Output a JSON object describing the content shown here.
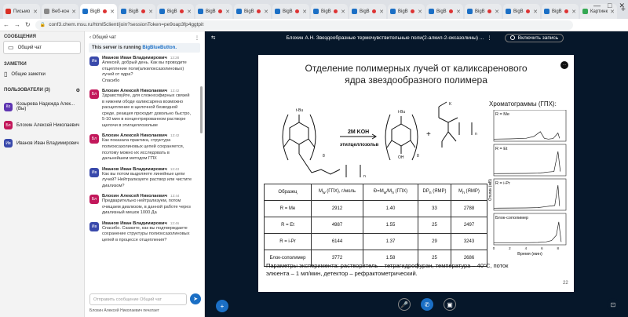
{
  "tabs": [
    {
      "label": "Письмо",
      "fav": "#d93025",
      "active": false,
      "rec": false
    },
    {
      "label": "Веб-кон",
      "fav": "#888888",
      "active": false,
      "rec": false
    },
    {
      "label": "BigB",
      "fav": "#1b6fc5",
      "active": true,
      "rec": true
    },
    {
      "label": "BigB",
      "fav": "#1b6fc5",
      "active": false,
      "rec": true
    },
    {
      "label": "BigB",
      "fav": "#1b6fc5",
      "active": false,
      "rec": true
    },
    {
      "label": "BigB",
      "fav": "#1b6fc5",
      "active": false,
      "rec": true
    },
    {
      "label": "BigB",
      "fav": "#1b6fc5",
      "active": false,
      "rec": true
    },
    {
      "label": "BigB",
      "fav": "#1b6fc5",
      "active": false,
      "rec": true
    },
    {
      "label": "BigB",
      "fav": "#1b6fc5",
      "active": false,
      "rec": true
    },
    {
      "label": "BigB",
      "fav": "#1b6fc5",
      "active": false,
      "rec": true
    },
    {
      "label": "BigB",
      "fav": "#1b6fc5",
      "active": false,
      "rec": true
    },
    {
      "label": "BigB",
      "fav": "#1b6fc5",
      "active": false,
      "rec": true
    },
    {
      "label": "BigB",
      "fav": "#1b6fc5",
      "active": false,
      "rec": true
    },
    {
      "label": "BigB",
      "fav": "#1b6fc5",
      "active": false,
      "rec": true
    },
    {
      "label": "BigB",
      "fav": "#1b6fc5",
      "active": false,
      "rec": true
    },
    {
      "label": "Картинк",
      "fav": "#34a853",
      "active": false,
      "rec": false
    }
  ],
  "window_controls": {
    "minimize": "—",
    "maximize": "□",
    "close": "✕"
  },
  "address": {
    "back": "←",
    "forward": "→",
    "reload": "↻",
    "lock": "🔒",
    "url": "conf3.chem.msu.ru/html5client/join?sessionToken=pe9oap3fp4ggtpit"
  },
  "nav": {
    "messages_title": "СООБЩЕНИЯ",
    "public_chat": "Общий чат",
    "notes_title": "ЗАМЕТКИ",
    "shared_notes": "Общие заметки",
    "users_title": "ПОЛЬЗОВАТЕЛИ (3)",
    "users": [
      {
        "initials": "Ко",
        "name": "Козырева Надежда Алек...(Вы)",
        "color": "#5e35b1"
      },
      {
        "initials": "Бл",
        "name": "Блохин Алексей Николаевич",
        "color": "#c2185b"
      },
      {
        "initials": "Ив",
        "name": "Иванов Иван Владимирович",
        "color": "#3949ab"
      }
    ]
  },
  "chat": {
    "header": "Общий чат",
    "back": "‹",
    "menu": "⋮",
    "banner_prefix": "This server is running ",
    "banner_link": "BigBlueButton.",
    "messages": [
      {
        "initials": "Ив",
        "color": "#3949ab",
        "name": "Иванов Иван Владимирович",
        "time": "13:28",
        "lines": [
          "Алексей, добрый день. Как вы проводите",
          "отщепление поли(алкилоксазолиновых)",
          "лучей от ядра?",
          "Спасибо"
        ]
      },
      {
        "initials": "Бл",
        "color": "#c2185b",
        "name": "Блохин Алексей Николаевич",
        "time": "13:42",
        "lines": [
          "Здравствуйте, для сложноэфирных связей",
          "в нижнем ободе каликсарена возможно",
          "расщепление в щелочной безводной",
          "среде, реакция проходит довольно быстро,",
          "5-10 мин в концентрированном растворе",
          "щелочи в этилцеллозольве"
        ]
      },
      {
        "initials": "Бл",
        "color": "#c2185b",
        "name": "Блохин Алексей Николаевич",
        "time": "13:42",
        "lines": [
          "Как показала практика, структура",
          "полиоксазолиновых цепей сохраняется,",
          "поэтому можно их исследовать в",
          "дальнейшем методом ГПХ"
        ]
      },
      {
        "initials": "Ив",
        "color": "#3949ab",
        "name": "Иванов Иван Владимирович",
        "time": "13:43",
        "lines": [
          "Как вы потом выделяете линейные цепи",
          "лучей? Нейтрализуете раствор или чистите",
          "диализом?"
        ]
      },
      {
        "initials": "Бл",
        "color": "#c2185b",
        "name": "Блохин Алексей Николаевич",
        "time": "13:44",
        "lines": [
          "Предварительно нейтрализуем, потом",
          "очищаем диализом, в данной работе через",
          "диализный мешок 1000 Да"
        ]
      },
      {
        "initials": "Ив",
        "color": "#3949ab",
        "name": "Иванов Иван Владимирович",
        "time": "13:46",
        "lines": [
          "Спасибо. Скажите, как вы подтверждаете",
          "сохранение структуры полиоксазолиновых",
          "цепей в процессе отщепления?"
        ]
      }
    ],
    "input_placeholder": "Отправить сообщение Общий чат",
    "typing": "Блохин Алексей Николаевич печатает"
  },
  "presentation": {
    "meeting_title": "Блохин А.Н. Звездообразные термочувствительные поли(2-алкил-2-оксазолины) ...",
    "more": "⋮",
    "record_label": "Включить запись",
    "slide_title_1": "Отделение полимерных лучей от каликсаренового",
    "slide_title_2": "ядра звездообразного полимера",
    "reaction": {
      "reagent": "2M KOH",
      "solvent": "этилцеллозольв",
      "tbu": "t-Bu",
      "oh": "OH",
      "plus": "+",
      "k": "K",
      "n1": "n",
      "n2": "n",
      "n8": "8",
      "n8b": "8"
    },
    "chrom_title": "Хроматограммы (ГПХ):",
    "chart_data": [
      {
        "type": "line",
        "series": [
          {
            "name": "R = Me",
            "x": [
              0,
              2,
              4,
              5,
              5.8,
              6.3,
              6.8,
              7.4,
              8,
              8.2
            ],
            "y": [
              0.02,
              0.03,
              0.05,
              0.12,
              0.3,
              0.05,
              0.02,
              0.04,
              0.25,
              0.05
            ]
          }
        ],
        "xlim": [
          0,
          9
        ]
      },
      {
        "type": "line",
        "series": [
          {
            "name": "R = Et",
            "x": [
              0,
              4,
              5.5,
              6.2,
              6.7,
              7.5,
              8,
              8.3
            ],
            "y": [
              0.02,
              0.03,
              0.04,
              0.06,
              0.08,
              0.1,
              0.85,
              0.1
            ]
          }
        ],
        "xlim": [
          0,
          9
        ]
      },
      {
        "type": "line",
        "series": [
          {
            "name": "R = i-Pr",
            "x": [
              0,
              4,
              5.5,
              6.5,
              7,
              7.6,
              8,
              8.2
            ],
            "y": [
              0.02,
              0.03,
              0.04,
              0.08,
              0.1,
              0.12,
              0.88,
              0.1
            ]
          }
        ],
        "xlim": [
          0,
          9
        ]
      },
      {
        "type": "line",
        "series": [
          {
            "name": "Блок-сополимер",
            "x": [
              0,
              4,
              5.5,
              6.5,
              7.2,
              7.8,
              8.1,
              8.4
            ],
            "y": [
              0.02,
              0.02,
              0.03,
              0.05,
              0.1,
              0.3,
              0.8,
              0.05
            ]
          }
        ],
        "xlim": [
          0,
          9
        ],
        "xlabel": "Время (мин)",
        "ylabel": "Отклик (мВ)",
        "xticks": [
          "0",
          "2",
          "4",
          "6",
          "8"
        ]
      }
    ],
    "table": {
      "headers": [
        "Образец",
        "M<sub>w</sub> (ГПХ), г/моль",
        "Đ=M<sub>w</sub>/M<sub>n</sub> (ГПХ)",
        "DP<sub>n</sub> (ЯМР)",
        "M<sub>n</sub> (ЯМР)"
      ],
      "rows": [
        [
          "R = Me",
          "2912",
          "1.40",
          "33",
          "2788"
        ],
        [
          "R = Et",
          "4987",
          "1.55",
          "25",
          "2497"
        ],
        [
          "R = i-Pr",
          "6144",
          "1.37",
          "29",
          "3243"
        ],
        [
          "Блок-сополимер",
          "3772",
          "1.58",
          "25",
          "2686"
        ]
      ]
    },
    "params_1": "Параметры эксперимента: растворитель – тетрагидрофуран, температура – 40°C, поток",
    "params_2": "элюента – 1 мл/мин, детектор – рефрактометрический.",
    "page_num": "22",
    "controls": {
      "plus": "+",
      "mic": "🎤",
      "phone": "✆",
      "video": "▣",
      "share": "⊡"
    }
  }
}
